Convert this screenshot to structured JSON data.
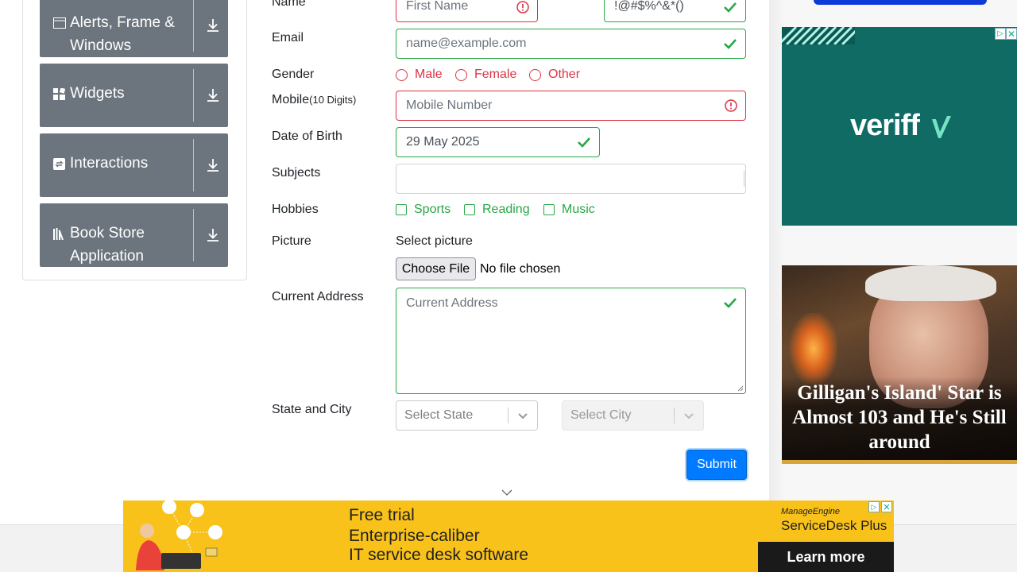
{
  "sidebar": {
    "groups": [
      {
        "label_line1": "Alerts, Frame &",
        "label_line2": "Windows",
        "icon": "window-icon"
      },
      {
        "label": "Widgets",
        "icon": "widgets-icon"
      },
      {
        "label": "Interactions",
        "icon": "interactions-icon"
      },
      {
        "label_line1": "Book Store",
        "label_line2": "Application",
        "icon": "books-icon"
      }
    ]
  },
  "form": {
    "name_label": "Name",
    "first_name_placeholder": "First Name",
    "last_name_value": "!@#$%^&*()",
    "email_label": "Email",
    "email_placeholder": "name@example.com",
    "gender_label": "Gender",
    "gender_options": [
      "Male",
      "Female",
      "Other"
    ],
    "mobile_label": "Mobile",
    "mobile_hint": "(10 Digits)",
    "mobile_placeholder": "Mobile Number",
    "dob_label": "Date of Birth",
    "dob_value": "29 May 2025",
    "subjects_label": "Subjects",
    "hobbies_label": "Hobbies",
    "hobbies": [
      "Sports",
      "Reading",
      "Music"
    ],
    "picture_label": "Picture",
    "select_picture": "Select picture",
    "choose_file": "Choose File",
    "no_file": "No file chosen",
    "address_label": "Current Address",
    "address_placeholder": "Current Address",
    "state_city_label": "State and City",
    "state_placeholder": "Select State",
    "city_placeholder": "Select City",
    "submit": "Submit"
  },
  "ads": {
    "veriff_brand": "veriff",
    "gilligan_headline": "Gilligan's Island' Star is Almost 103 and He's Still around",
    "banner": {
      "line1": "Free trial",
      "line2": "Enterprise-caliber",
      "line3": "IT service desk software",
      "brand_top": "ManageEngine",
      "brand": "ServiceDesk Plus",
      "cta": "Learn more"
    }
  },
  "colors": {
    "valid": "#28a745",
    "invalid": "#dc3545",
    "primary": "#007bff",
    "ad_yellow": "#f9c21a",
    "veriff_bg": "#0f6b64"
  }
}
